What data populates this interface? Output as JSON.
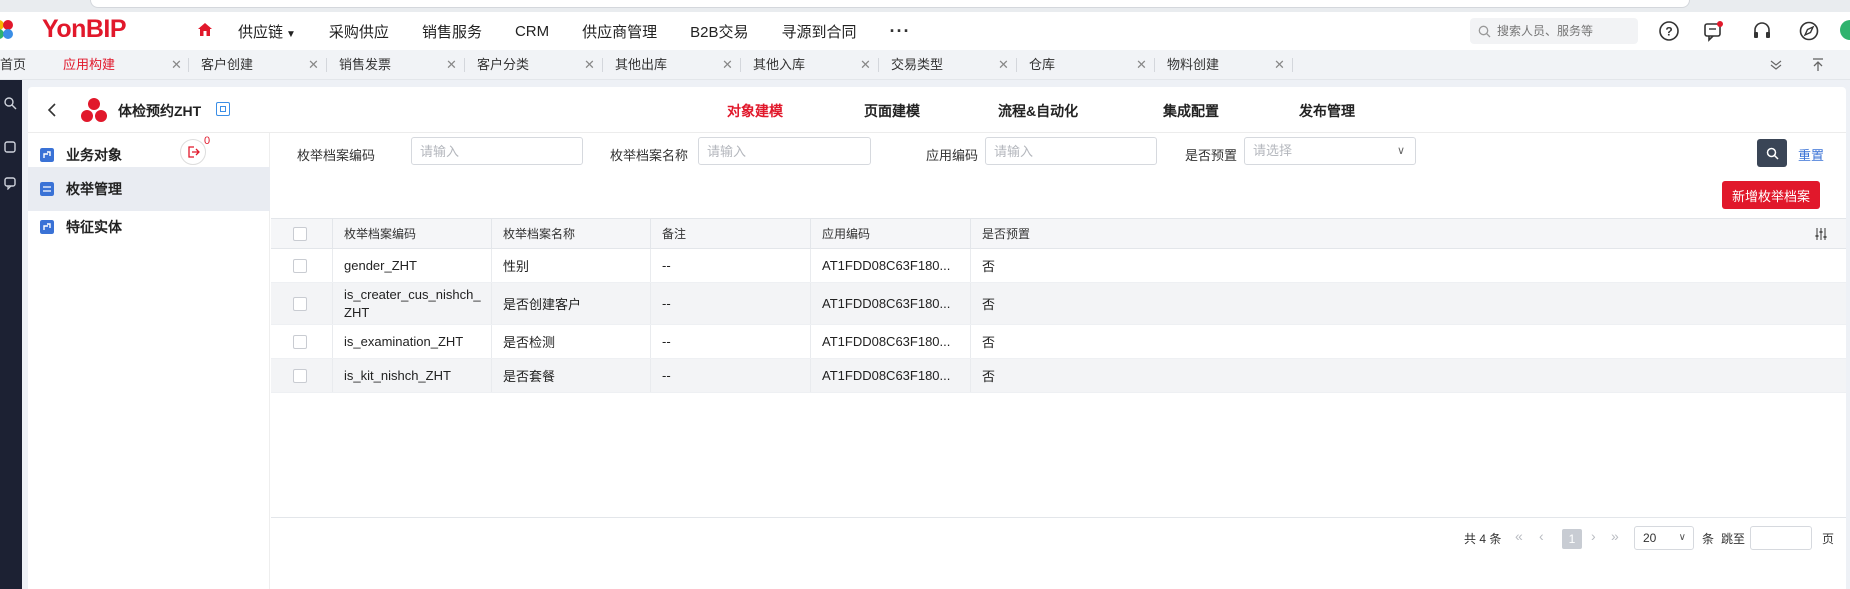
{
  "brand": {
    "name": "YonBIP"
  },
  "nav": {
    "items": [
      "供应链",
      "采购供应",
      "销售服务",
      "CRM",
      "供应商管理",
      "B2B交易",
      "寻源到合同"
    ],
    "more": "···"
  },
  "search": {
    "placeholder": "搜索人员、服务等"
  },
  "tabs": [
    {
      "label": "首页"
    },
    {
      "label": "应用构建",
      "active": true
    },
    {
      "label": "客户创建"
    },
    {
      "label": "销售发票"
    },
    {
      "label": "客户分类"
    },
    {
      "label": "其他出库"
    },
    {
      "label": "其他入库"
    },
    {
      "label": "交易类型"
    },
    {
      "label": "仓库"
    },
    {
      "label": "物料创建"
    }
  ],
  "app": {
    "title": "体检预约ZHT",
    "tabs": [
      "对象建模",
      "页面建模",
      "流程&自动化",
      "集成配置",
      "发布管理"
    ],
    "active_tab": "对象建模"
  },
  "sidebar": {
    "items": [
      "业务对象",
      "枚举管理",
      "特征实体"
    ],
    "active": "枚举管理",
    "badge_count": "0"
  },
  "filters": {
    "code_label": "枚举档案编码",
    "code_placeholder": "请输入",
    "name_label": "枚举档案名称",
    "name_placeholder": "请输入",
    "app_code_label": "应用编码",
    "app_code_placeholder": "请输入",
    "preset_label": "是否预置",
    "preset_placeholder": "请选择",
    "reset": "重置"
  },
  "toolbar": {
    "new_button": "新增枚举档案"
  },
  "table": {
    "headers": [
      "枚举档案编码",
      "枚举档案名称",
      "备注",
      "应用编码",
      "是否预置"
    ],
    "rows": [
      [
        "gender_ZHT",
        "性别",
        "--",
        "AT1FDD08C63F180...",
        "否"
      ],
      [
        "is_creater_cus_nishch_ZHT",
        "是否创建客户",
        "--",
        "AT1FDD08C63F180...",
        "否"
      ],
      [
        "is_examination_ZHT",
        "是否检测",
        "--",
        "AT1FDD08C63F180...",
        "否"
      ],
      [
        "is_kit_nishch_ZHT",
        "是否套餐",
        "--",
        "AT1FDD08C63F180...",
        "否"
      ]
    ]
  },
  "pagination": {
    "total": "共 4 条",
    "current_page": "1",
    "page_size": "20",
    "unit": "条",
    "jump_label": "跳至",
    "page_label": "页"
  },
  "colors": {
    "brand_red": "#e1182b",
    "link_blue": "#3a72d6",
    "rail": "#1c2133"
  }
}
